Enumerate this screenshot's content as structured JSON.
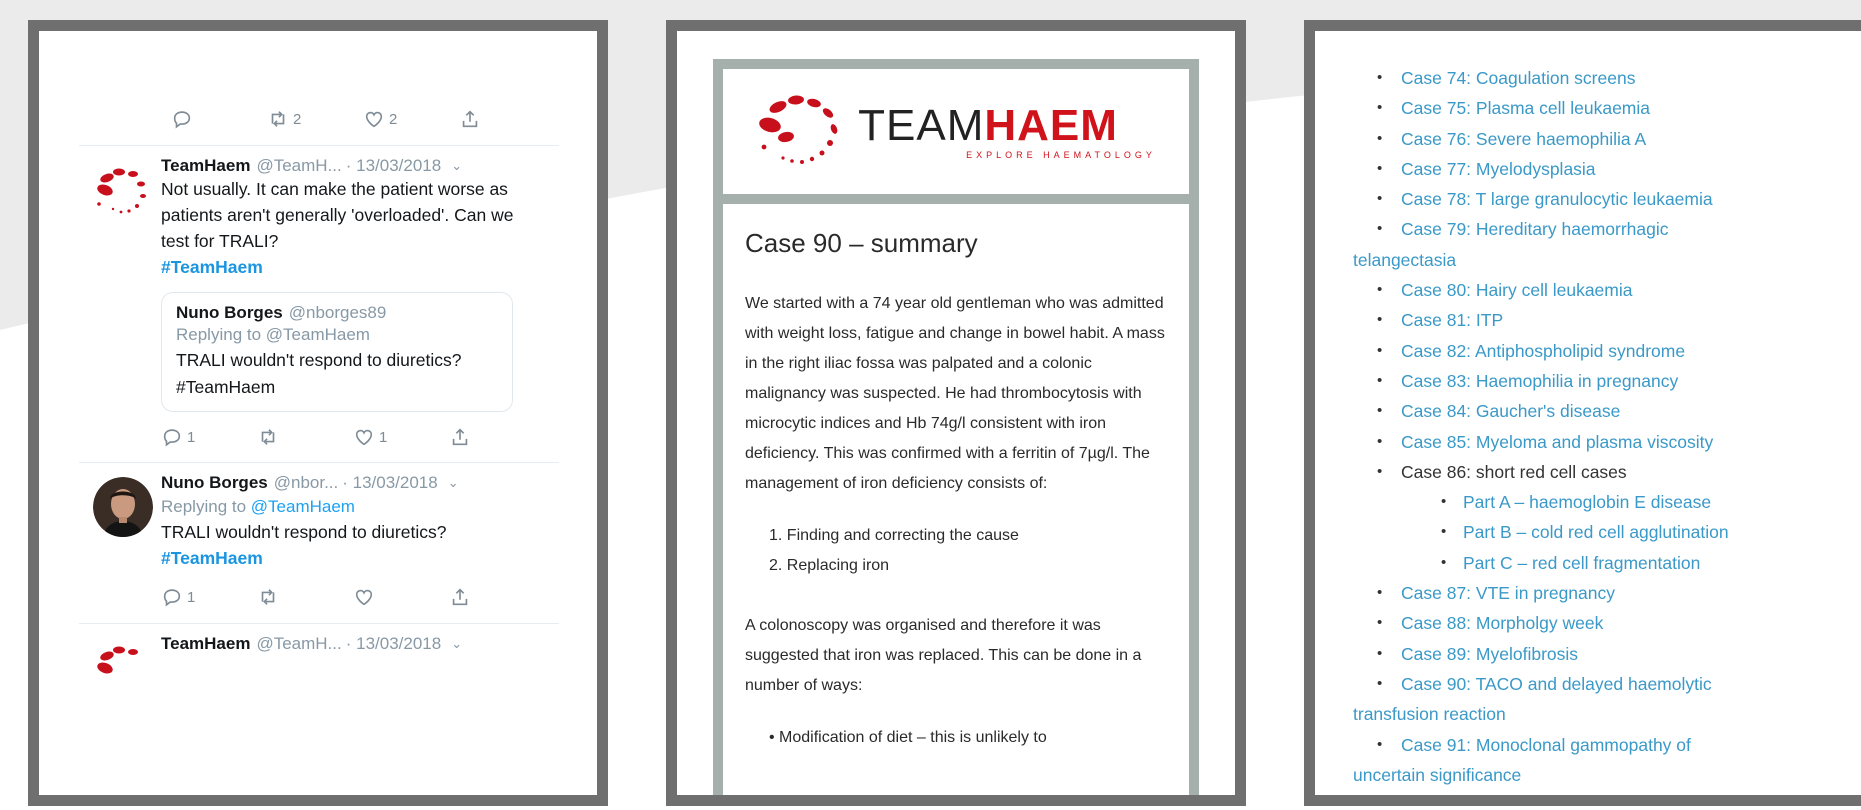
{
  "tweets_panel": {
    "top_actions": {
      "reply": "",
      "retweet": "2",
      "like": "2"
    },
    "tweets": [
      {
        "name": "TeamHaem",
        "handle": "@TeamH...",
        "date": "· 13/03/2018",
        "text": "Not usually. It can make the patient worse as patients aren't generally 'overloaded'. Can we test for TRALI?",
        "hashtag": "#TeamHaem",
        "quote": {
          "name": "Nuno Borges",
          "handle": "@nborges89",
          "replying": "Replying to @TeamHaem",
          "text": "TRALI wouldn't respond to diuretics? #TeamHaem"
        },
        "actions": {
          "reply": "1",
          "retweet": "",
          "like": "1"
        }
      },
      {
        "name": "Nuno Borges",
        "handle": "@nbor...",
        "date": "· 13/03/2018",
        "replying_prefix": "Replying to",
        "replying_handle": "@TeamHaem",
        "text": "TRALI wouldn't respond to diuretics?",
        "hashtag": "#TeamHaem",
        "actions": {
          "reply": "1",
          "retweet": "",
          "like": ""
        }
      },
      {
        "name": "TeamHaem",
        "handle": "@TeamH...",
        "date": "· 13/03/2018"
      }
    ]
  },
  "article_panel": {
    "logo": {
      "word_light": "TEAM",
      "word_bold": "HAEM",
      "tagline": "EXPLORE HAEMATOLOGY"
    },
    "title": "Case 90 – summary",
    "para1": "We started with a 74 year old gentleman who was admitted with weight loss, fatigue and change in bowel habit. A mass in the right iliac fossa was palpated and a colonic malignancy was suspected. He had thrombocytosis with microcytic indices and Hb 74g/l consistent with iron deficiency. This was confirmed with a ferritin of 7µg/l. The management of iron deficiency consists of:",
    "steps": [
      "1.  Finding and correcting the cause",
      "2.  Replacing iron"
    ],
    "para2": "A colonoscopy was organised and therefore it was suggested that iron was replaced. This can be done in a number of ways:",
    "bullets": [
      "•   Modification of diet – this is unlikely to"
    ]
  },
  "cases_panel": {
    "items": [
      "Case 74: Coagulation screens",
      "Case 75: Plasma cell leukaemia",
      "Case 76: Severe haemophilia A",
      "Case 77: Myelodysplasia",
      "Case 78: T large granulocytic leukaemia",
      "Case 79: Hereditary haemorrhagic",
      "telangectasia",
      "Case 80: Hairy cell leukaemia",
      "Case 81: ITP",
      "Case 82: Antiphospholipid syndrome",
      "Case 83: Haemophilia in pregnancy",
      "Case 84: Gaucher's disease",
      "Case 85: Myeloma and plasma viscosity",
      "Case 86: short red cell cases",
      "Part A – haemoglobin E disease",
      "Part B – cold red cell agglutination",
      "Part C – red cell fragmentation",
      "Case 87: VTE in pregnancy",
      "Case 88: Morpholgy week",
      "Case 89: Myelofibrosis",
      "Case 90: TACO and delayed haemolytic",
      "transfusion reaction",
      "Case 91: Monoclonal gammopathy of",
      "uncertain significance"
    ]
  },
  "colors": {
    "link": "#3a99c8",
    "twitter_blue": "#1b95e0",
    "brand_red": "#d0121b",
    "frame": "#6f6f6f",
    "article_border": "#a5afac"
  }
}
